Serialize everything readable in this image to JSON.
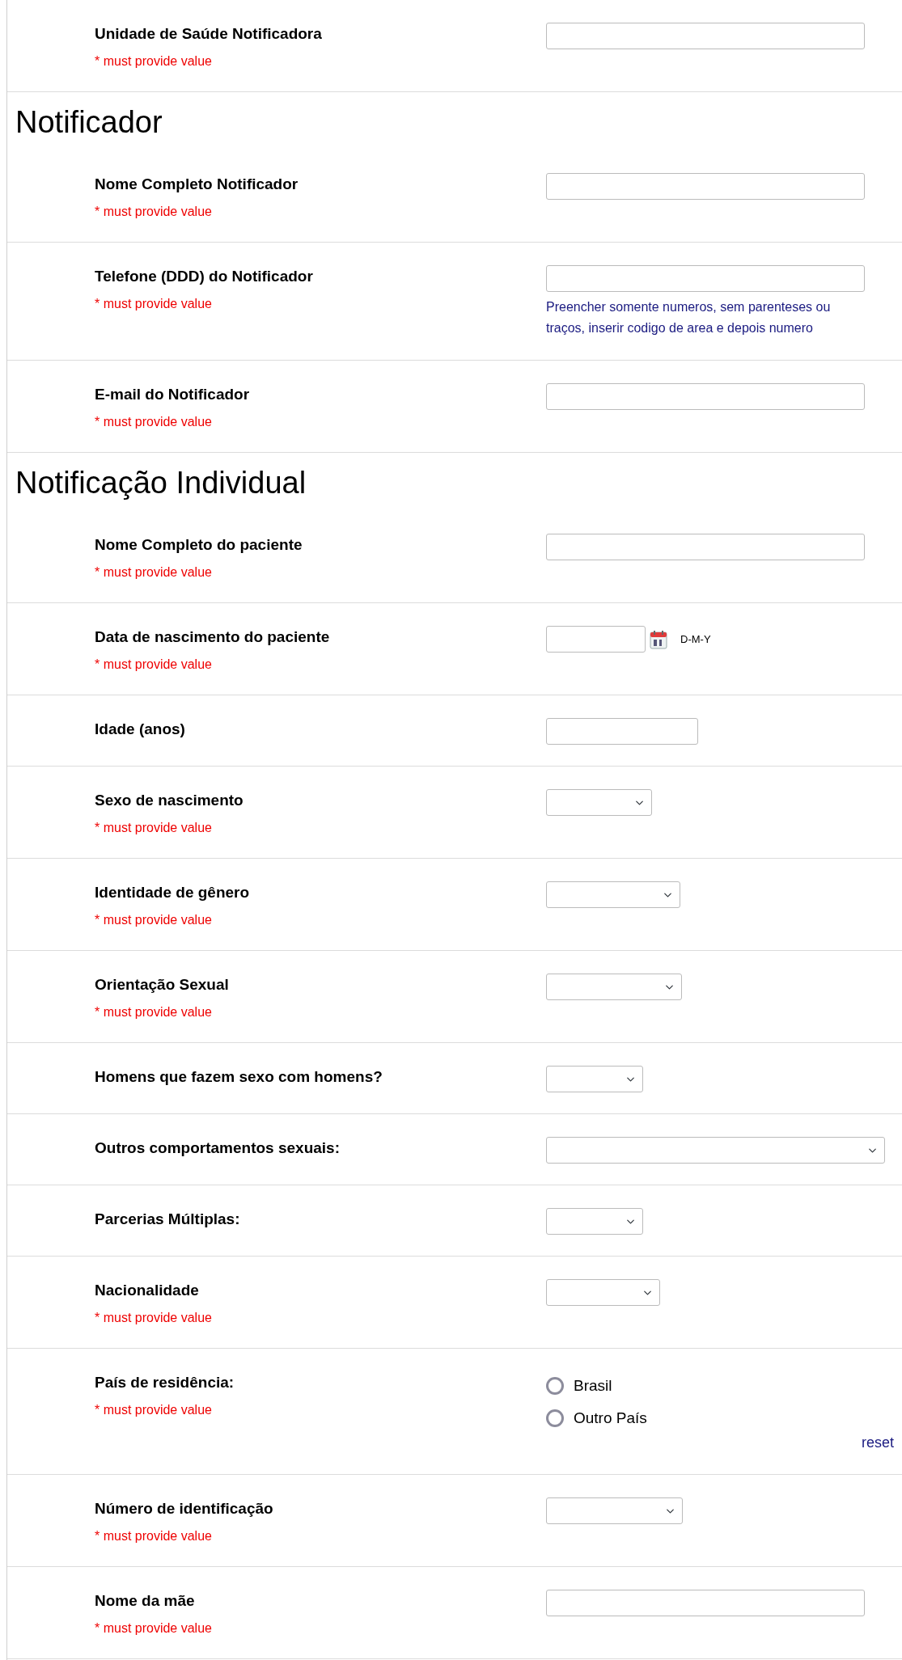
{
  "sections": [
    {
      "fields": [
        {
          "kind": "text",
          "label": "Unidade de Saúde Notificadora",
          "required_note": "* must provide value"
        }
      ]
    },
    {
      "heading": "Notificador",
      "fields": [
        {
          "kind": "text",
          "label": "Nome Completo Notificador",
          "required_note": "* must provide value"
        },
        {
          "kind": "text",
          "label": "Telefone (DDD) do Notificador",
          "required_note": "* must provide value",
          "note": "Preencher somente numeros, sem parenteses ou traços, inserir codigo de area e depois numero"
        },
        {
          "kind": "text",
          "label": "E-mail do Notificador",
          "required_note": "* must provide value"
        }
      ]
    },
    {
      "heading": "Notificação Individual",
      "fields": [
        {
          "kind": "text",
          "label": "Nome Completo do paciente",
          "required_note": "* must provide value"
        },
        {
          "kind": "date",
          "label": "Data de nascimento do paciente",
          "required_note": "* must provide value",
          "format_hint": "D-M-Y"
        },
        {
          "kind": "short",
          "label": "Idade (anos)"
        },
        {
          "kind": "select",
          "label": "Sexo de nascimento",
          "required_note": "* must provide value"
        },
        {
          "kind": "select",
          "label": "Identidade de gênero",
          "required_note": "* must provide value"
        },
        {
          "kind": "select",
          "label": "Orientação Sexual",
          "required_note": "* must provide value"
        },
        {
          "kind": "select",
          "label": "Homens que fazem sexo com homens?"
        },
        {
          "kind": "select",
          "label": "Outros comportamentos sexuais:"
        },
        {
          "kind": "select",
          "label": "Parcerias Múltiplas:"
        },
        {
          "kind": "select",
          "label": "Nacionalidade",
          "required_note": "* must provide value"
        },
        {
          "kind": "radio",
          "label": "País de residência:",
          "required_note": "* must provide value",
          "options": [
            {
              "label": "Brasil",
              "selected": false
            },
            {
              "label": "Outro País",
              "selected": false
            }
          ],
          "reset_label": "reset"
        },
        {
          "kind": "select",
          "label": "Número de identificação",
          "required_note": "* must provide value"
        },
        {
          "kind": "text",
          "label": "Nome da mãe",
          "required_note": "* must provide value"
        }
      ]
    }
  ]
}
